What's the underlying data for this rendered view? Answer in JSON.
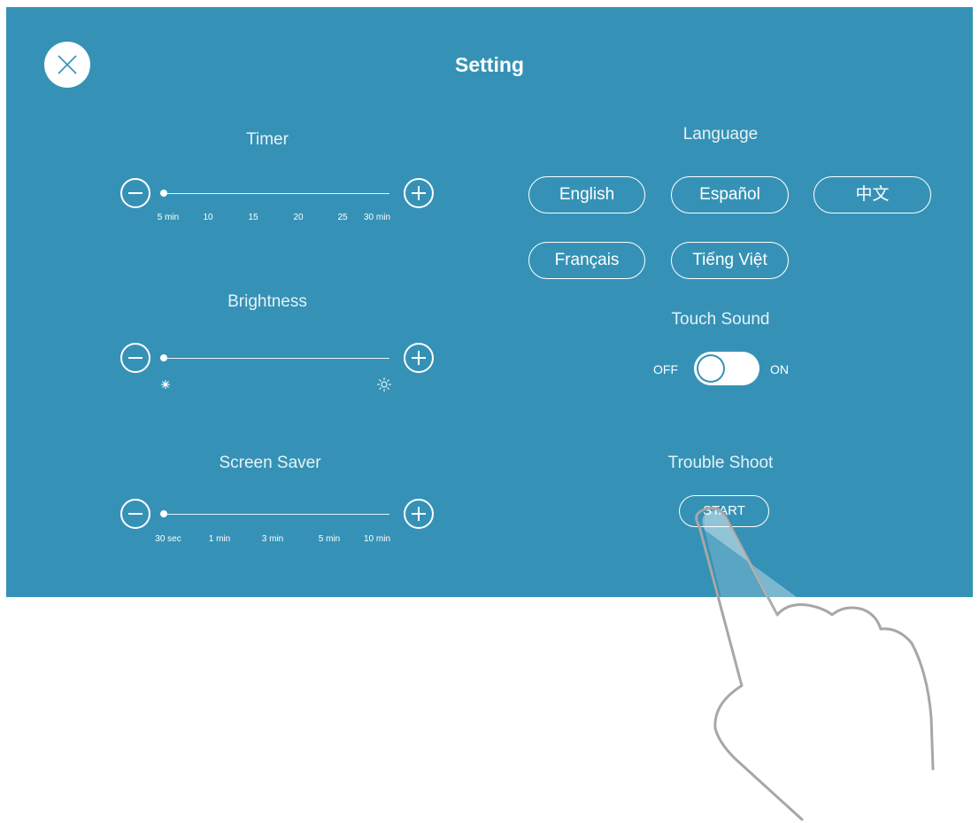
{
  "header": {
    "title": "Setting"
  },
  "timer": {
    "label": "Timer",
    "ticks": [
      "5 min",
      "10",
      "15",
      "20",
      "25",
      "30 min"
    ],
    "value": "5 min"
  },
  "brightness": {
    "label": "Brightness",
    "min_icon": "dim-brightness-icon",
    "max_icon": "bright-brightness-icon",
    "value_fraction": 0
  },
  "screen_saver": {
    "label": "Screen Saver",
    "ticks": [
      "30 sec",
      "1 min",
      "3 min",
      "5 min",
      "10 min"
    ],
    "value": "30 sec"
  },
  "language": {
    "label": "Language",
    "options": [
      "English",
      "Español",
      "中文",
      "Français",
      "Tiếng Việt"
    ],
    "selected": "English"
  },
  "touch_sound": {
    "label": "Touch Sound",
    "off_label": "OFF",
    "on_label": "ON",
    "state": "ON"
  },
  "trouble_shoot": {
    "label": "Trouble Shoot",
    "button_label": "START"
  },
  "colors": {
    "panel": "#3592b6",
    "foreground": "#ffffff",
    "hand_outline": "#a7a7a7"
  }
}
